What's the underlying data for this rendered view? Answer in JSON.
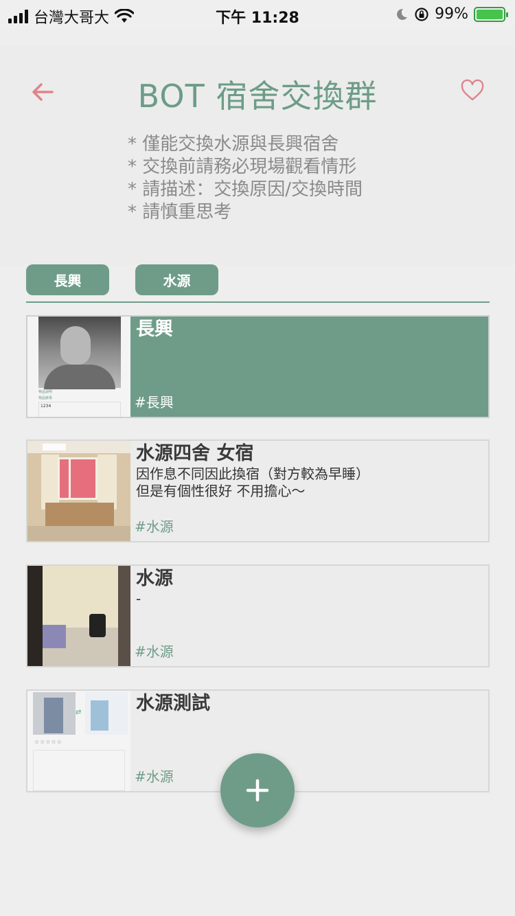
{
  "status_bar": {
    "carrier": "台灣大哥大",
    "time": "下午 11:28",
    "battery_percent": "99%",
    "battery_level": 0.99,
    "icons": [
      "signal-icon",
      "wifi-icon",
      "moon-icon",
      "orientation-lock-icon",
      "battery-charging-icon"
    ]
  },
  "header": {
    "title": "BOT 宿舍交換群",
    "back_icon": "arrow-left-icon",
    "favorite_icon": "heart-icon",
    "rules": [
      "* 僅能交換水源與長興宿舍",
      "* 交換前請務必現場觀看情形",
      "* 請描述：交換原因/交換時間",
      "* 請慎重思考"
    ]
  },
  "tabs": [
    {
      "label": "長興"
    },
    {
      "label": "水源"
    }
  ],
  "posts": [
    {
      "title": "長興",
      "description": "",
      "tag": "#長興",
      "active": true,
      "thumb_caption_1": "物品說明",
      "thumb_caption_2": "物品敘事",
      "thumb_box_text": "1234"
    },
    {
      "title": "水源四舍 女宿",
      "description": "因作息不同因此換宿（對方較為早睡）\n但是有個性很好 不用擔心～",
      "tag": "#水源",
      "active": false
    },
    {
      "title": "水源",
      "description": "-",
      "tag": "#水源",
      "active": false
    },
    {
      "title": "水源測試",
      "description": "",
      "tag": "#水源",
      "active": false,
      "thumb_stars": "☆☆☆☆☆"
    }
  ],
  "fab": {
    "icon": "plus-icon"
  },
  "colors": {
    "accent": "#6e9c88",
    "title": "#6c9c87",
    "back_arrow": "#e0838a",
    "heart": "#e0838a",
    "background": "#eeeeee"
  }
}
